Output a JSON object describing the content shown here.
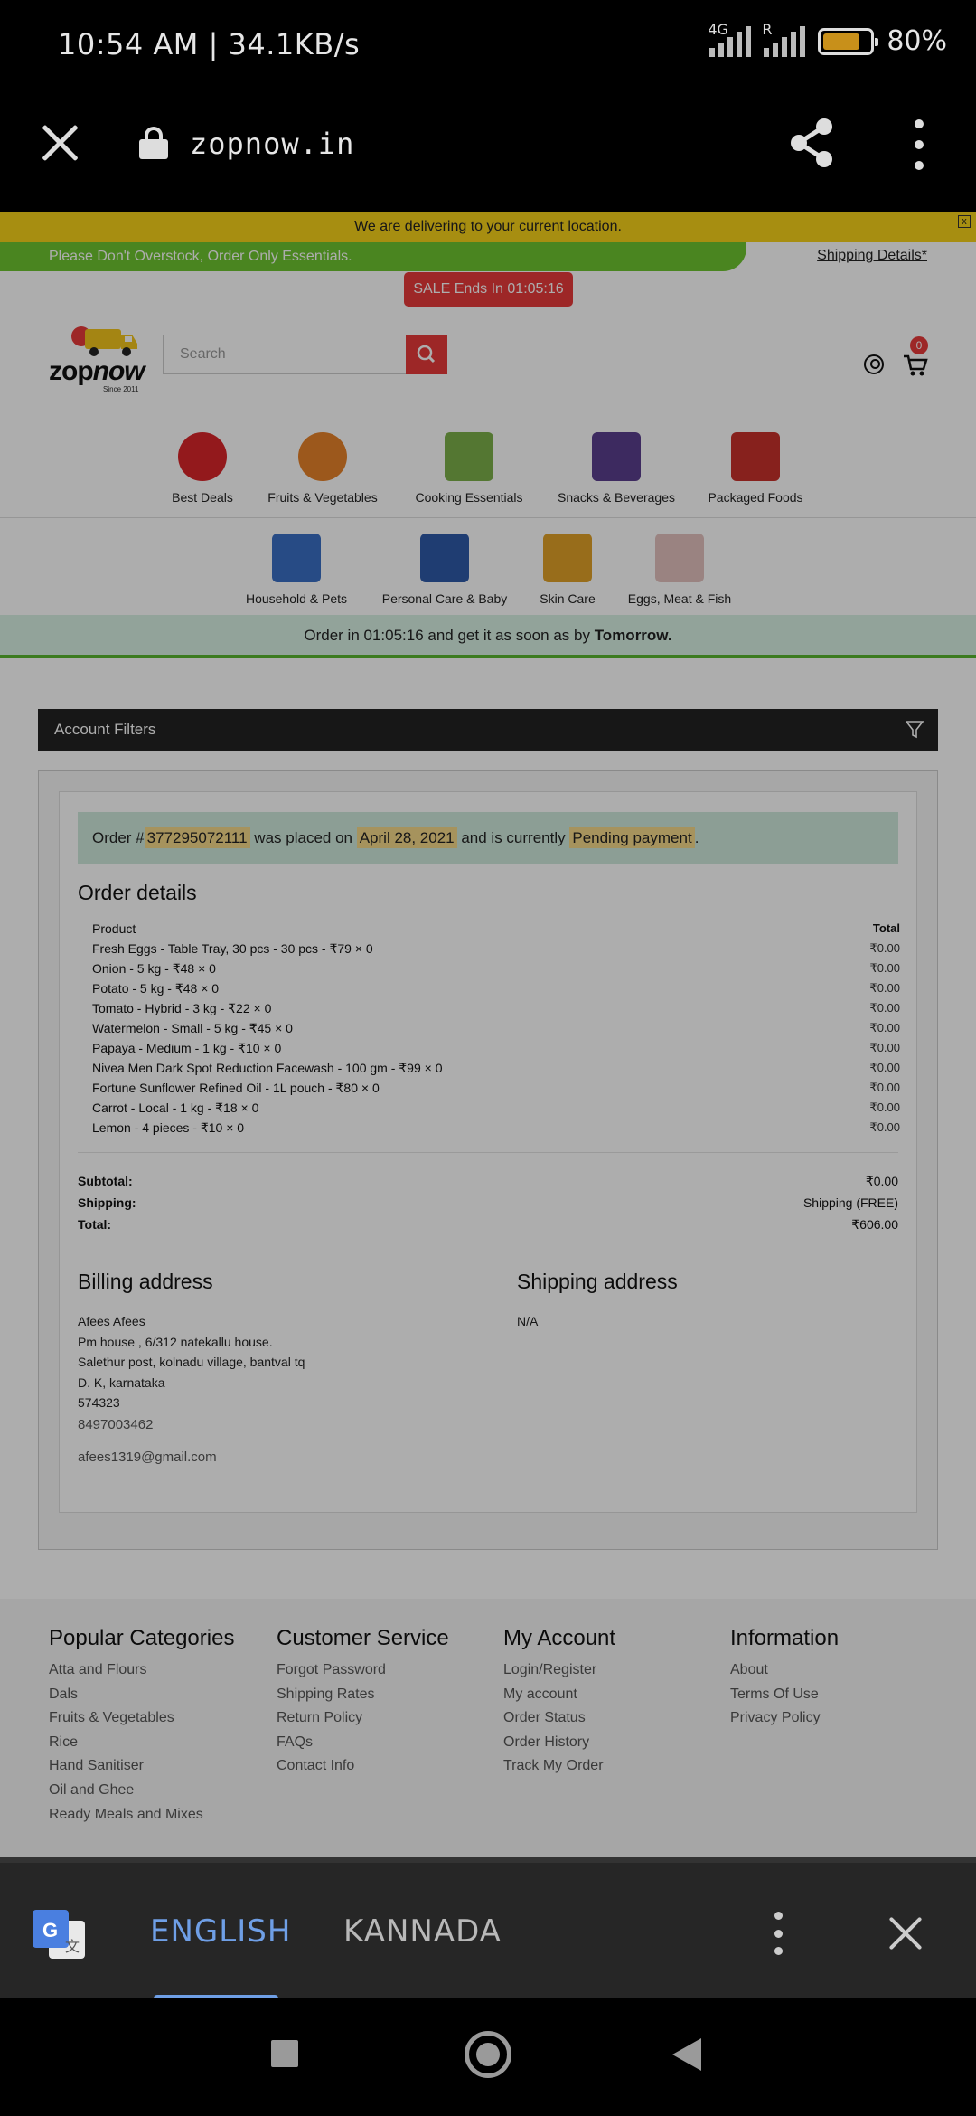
{
  "status_bar": {
    "time": "10:54 AM | 34.1KB/s",
    "network_1": "4G",
    "network_2": "R",
    "battery_pct": "80%",
    "battery_level": 0.8
  },
  "browser": {
    "url": "zopnow.in"
  },
  "page": {
    "delivery_notice": "We are delivering to your current location.",
    "promo_text": "Please Don't Overstock, Order Only Essentials.",
    "shipping_link": "Shipping Details*",
    "sale_badge": "SALE Ends In 01:05:16",
    "logo": {
      "name_a": "zop",
      "name_b": "now",
      "since": "Since 2011"
    },
    "search_placeholder": "Search",
    "cart_count": "0",
    "categories": [
      "Best Deals",
      "Fruits & Vegetables",
      "Cooking Essentials",
      "Snacks & Beverages",
      "Packaged Foods",
      "Household & Pets",
      "Personal Care & Baby",
      "Skin Care",
      "Eggs, Meat & Fish"
    ],
    "order_timer": {
      "prefix": "Order in 01:05:16 and get it as soon as by ",
      "strong": "Tomorrow."
    },
    "account_filters": "Account Filters",
    "order_notice": {
      "t1": "Order #",
      "order_no": "377295072111",
      "t2": " was placed on ",
      "date": "April 28, 2021",
      "t3": " and is currently ",
      "status": "Pending payment",
      "t4": "."
    },
    "order_details_title": "Order details",
    "product_header": "Product",
    "total_header": "Total",
    "products": [
      {
        "name": "Fresh Eggs - Table Tray, 30 pcs - 30 pcs - ₹79 × 0",
        "total": "₹0.00"
      },
      {
        "name": "Onion - 5 kg - ₹48 × 0",
        "total": "₹0.00"
      },
      {
        "name": "Potato - 5 kg - ₹48 × 0",
        "total": "₹0.00"
      },
      {
        "name": "Tomato - Hybrid - 3 kg - ₹22 × 0",
        "total": "₹0.00"
      },
      {
        "name": "Watermelon - Small - 5 kg - ₹45 × 0",
        "total": "₹0.00"
      },
      {
        "name": "Papaya - Medium - 1 kg - ₹10 × 0",
        "total": "₹0.00"
      },
      {
        "name": "Nivea Men Dark Spot Reduction Facewash - 100 gm - ₹99 × 0",
        "total": "₹0.00"
      },
      {
        "name": "Fortune Sunflower Refined Oil - 1L pouch - ₹80 × 0",
        "total": "₹0.00"
      },
      {
        "name": "Carrot - Local - 1 kg - ₹18 × 0",
        "total": "₹0.00"
      },
      {
        "name": "Lemon - 4 pieces - ₹10 × 0",
        "total": "₹0.00"
      }
    ],
    "totals": [
      {
        "label": "Subtotal:",
        "value": "₹0.00"
      },
      {
        "label": "Shipping:",
        "value": "Shipping (FREE)"
      },
      {
        "label": "Total:",
        "value": "₹606.00"
      }
    ],
    "billing": {
      "title": "Billing address",
      "lines": [
        "Afees Afees",
        "Pm house , 6/312 natekallu house.",
        "Salethur post, kolnadu village, bantval tq",
        "D. K, karnataka",
        "574323"
      ],
      "phone": "8497003462",
      "email": "afees1319@gmail.com"
    },
    "shipping": {
      "title": "Shipping address",
      "value": "N/A"
    },
    "footer": [
      {
        "title": "Popular Categories",
        "links": [
          "Atta and Flours",
          "Dals",
          "Fruits & Vegetables",
          "Rice",
          "Hand Sanitiser",
          "Oil and Ghee",
          "Ready Meals and Mixes"
        ]
      },
      {
        "title": "Customer Service",
        "links": [
          "Forgot Password",
          "Shipping Rates",
          "Return Policy",
          "FAQs",
          "Contact Info"
        ]
      },
      {
        "title": "My Account",
        "links": [
          "Login/Register",
          "My account",
          "Order Status",
          "Order History",
          "Track My Order"
        ]
      },
      {
        "title": "Information",
        "links": [
          "About",
          "Terms Of Use",
          "Privacy Policy"
        ]
      }
    ]
  },
  "translate_bar": {
    "lang_active": "ENGLISH",
    "lang_other": "KANNADA"
  },
  "colors": {
    "accent_red": "#e83a3a",
    "yellow": "#f7d21a",
    "green": "#6ec530",
    "translate_blue": "#6f9fe6"
  }
}
